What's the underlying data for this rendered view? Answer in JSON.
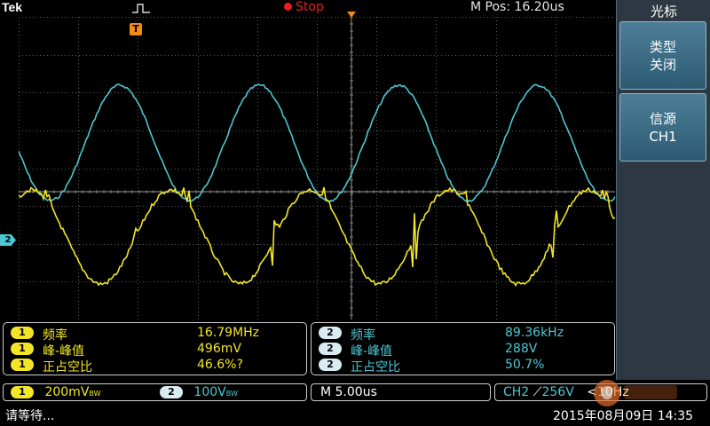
{
  "header": {
    "brand": "Tek",
    "run_status": "Stop",
    "horizontal_position": "M Pos: 16.20us"
  },
  "markers": {
    "trigger_level": "T",
    "ch2_reference": "2"
  },
  "menu": {
    "title": "光标",
    "buttons": [
      {
        "line1": "类型",
        "line2": "关闭"
      },
      {
        "line1": "信源",
        "line2": "CH1"
      }
    ]
  },
  "measurements": {
    "ch1": [
      {
        "channel": "1",
        "name": "频率",
        "value": "16.79MHz"
      },
      {
        "channel": "1",
        "name": "峰-峰值",
        "value": "496mV"
      },
      {
        "channel": "1",
        "name": "正占空比",
        "value": "46.6%?"
      }
    ],
    "ch2": [
      {
        "channel": "2",
        "name": "频率",
        "value": "89.36kHz"
      },
      {
        "channel": "2",
        "name": "峰-峰值",
        "value": "288V"
      },
      {
        "channel": "2",
        "name": "正占空比",
        "value": "50.7%"
      }
    ]
  },
  "status_bar": {
    "ch1_badge": "1",
    "ch1_scale": "200mV",
    "ch1_bw": "BW",
    "ch2_badge": "2",
    "ch2_scale": "100V",
    "ch2_bw": "BW",
    "timebase": "M 5.00us",
    "trigger_source": "CH2",
    "trigger_slope": "⟋",
    "trigger_level": "256V",
    "trigger_freq": "<10Hz",
    "message": "请等待...",
    "datetime": "2015年08月09日 14:35"
  },
  "colors": {
    "ch1": "#f2e625",
    "ch2": "#4ec6d2",
    "stop": "#e51d1d",
    "trigger": "#f08a1a",
    "menu_bg": "#2e3842"
  }
}
